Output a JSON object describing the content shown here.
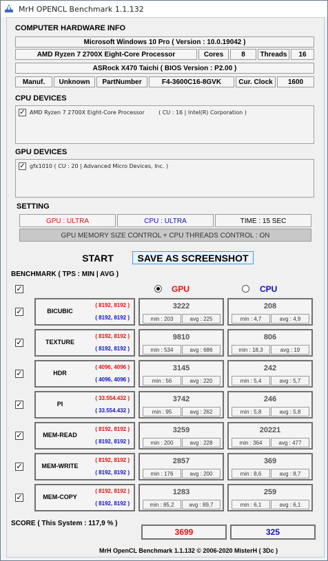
{
  "window": {
    "title": "MrH OPENCL Benchmark 1.1.132"
  },
  "hardware": {
    "heading": "COMPUTER HARDWARE INFO",
    "os": "Microsoft Windows 10 Pro ( Version : 10.0.19042 )",
    "cpu_name": "AMD Ryzen 7 2700X Eight-Core Processor",
    "cores_label": "Cores",
    "cores_value": "8",
    "threads_label": "Threads",
    "threads_value": "16",
    "board": "ASRock X470 Taichi ( BIOS Version : P2.00 )",
    "manuf_label": "Manuf.",
    "manuf_value": "Unknown",
    "part_label": "PartNumber",
    "part_value": "F4-3600C16-8GVK",
    "clock_label": "Cur. Clock",
    "clock_value": "1600"
  },
  "cpu_devices": {
    "heading": "CPU DEVICES",
    "item": "AMD Ryzen 7 2700X Eight-Core Processor        ( CU : 16 | Intel(R) Corporation )"
  },
  "gpu_devices": {
    "heading": "GPU DEVICES",
    "item": "gfx1010 ( CU : 20 | Advanced Micro Devices, Inc. )"
  },
  "setting": {
    "heading": "SETTING",
    "gpu": "GPU : ULTRA",
    "cpu": "CPU : ULTRA",
    "time": "TIME : 15 SEC",
    "control": "GPU MEMORY SIZE CONTROL + CPU THREADS CONTROL : ON"
  },
  "buttons": {
    "start": "START",
    "screenshot": "SAVE AS SCREENSHOT"
  },
  "benchmark": {
    "heading": "BENCHMARK ( TPS : MIN | AVG )",
    "gpu_label": "GPU",
    "cpu_label": "CPU",
    "rows": [
      {
        "name": "BICUBIC",
        "gpu_res": "( 8192, 8192 )",
        "cpu_res": "( 8192, 8192 )",
        "gpu_val": "3222",
        "gpu_min": "min : 203",
        "gpu_avg": "avg : 225",
        "cpu_val": "208",
        "cpu_min": "min : 4,7",
        "cpu_avg": "avg : 4,9"
      },
      {
        "name": "TEXTURE",
        "gpu_res": "( 8192, 8192 )",
        "cpu_res": "( 8192, 8192 )",
        "gpu_val": "9810",
        "gpu_min": "min : 534",
        "gpu_avg": "avg : 686",
        "cpu_val": "806",
        "cpu_min": "min : 18,3",
        "cpu_avg": "avg : 19"
      },
      {
        "name": "HDR",
        "gpu_res": "( 4096, 4096 )",
        "cpu_res": "( 4096, 4096 )",
        "gpu_val": "3145",
        "gpu_min": "min : 56",
        "gpu_avg": "avg : 220",
        "cpu_val": "242",
        "cpu_min": "min : 5,4",
        "cpu_avg": "avg : 5,7"
      },
      {
        "name": "PI",
        "gpu_res": "( 33.554.432 )",
        "cpu_res": "( 33.554.432 )",
        "gpu_val": "3742",
        "gpu_min": "min : 95",
        "gpu_avg": "avg : 262",
        "cpu_val": "246",
        "cpu_min": "min : 5,8",
        "cpu_avg": "avg : 5,8"
      },
      {
        "name": "MEM-READ",
        "gpu_res": "( 8192, 8192 )",
        "cpu_res": "( 8192, 8192 )",
        "gpu_val": "3259",
        "gpu_min": "min : 200",
        "gpu_avg": "avg : 228",
        "cpu_val": "20221",
        "cpu_min": "min : 364",
        "cpu_avg": "avg : 477"
      },
      {
        "name": "MEM-WRITE",
        "gpu_res": "( 8192, 8192 )",
        "cpu_res": "( 8192, 8192 )",
        "gpu_val": "2857",
        "gpu_min": "min : 176",
        "gpu_avg": "avg : 200",
        "cpu_val": "369",
        "cpu_min": "min : 8,6",
        "cpu_avg": "avg : 8,7"
      },
      {
        "name": "MEM-COPY",
        "gpu_res": "( 8192, 8192 )",
        "cpu_res": "( 8192, 8192 )",
        "gpu_val": "1283",
        "gpu_min": "min : 85,2",
        "gpu_avg": "avg : 89,7",
        "cpu_val": "259",
        "cpu_min": "min : 6,1",
        "cpu_avg": "avg : 6,1"
      }
    ]
  },
  "score": {
    "label": "SCORE ( This System : 117,9 % )",
    "gpu": "3699",
    "cpu": "325"
  },
  "footer": "MrH OpenCL Benchmark 1.1.132  ©  2006-2020 MisterH ( 3Dc )",
  "colors": {
    "gpu": "#e01010",
    "cpu": "#1010c0"
  }
}
